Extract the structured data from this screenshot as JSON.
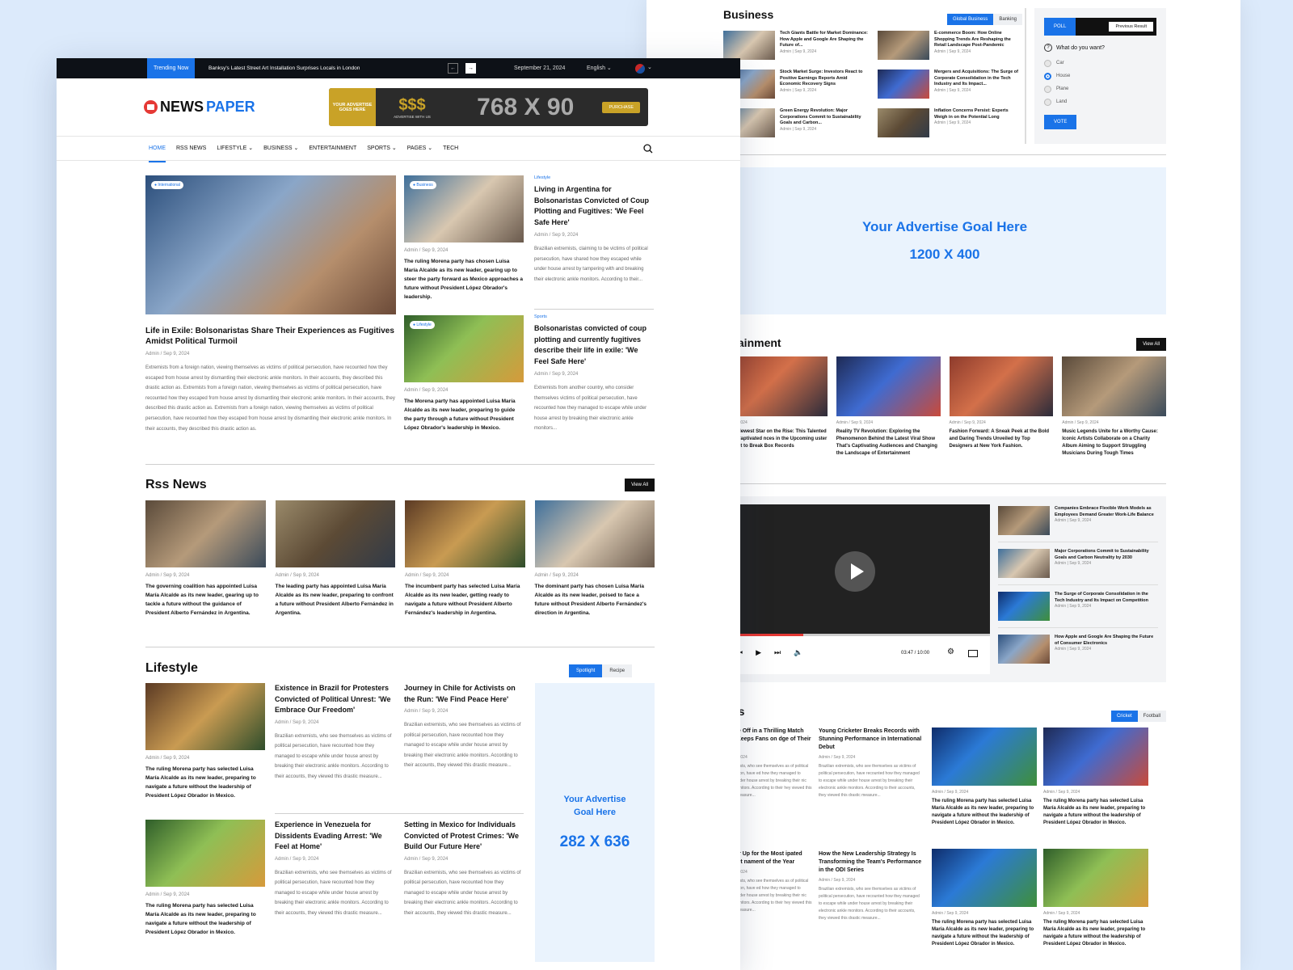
{
  "topbar": {
    "trending_label": "Trending Now",
    "trending_text": "Banksy's Latest Street Art Installation Surprises Locals in London",
    "date": "September 21, 2024",
    "language": "English"
  },
  "header": {
    "logo_news": "NEWS",
    "logo_paper": "PAPER",
    "ad_left": "YOUR ADVERTISE GOES HERE",
    "ad_dollars": "$$$",
    "ad_sub": "ADVERTISE WITH US",
    "ad_size": "768 X 90",
    "ad_button": "PURCHASE"
  },
  "nav": [
    "HOME",
    "RSS NEWS",
    "LIFESTYLE",
    "BUSINESS",
    "ENTERTAINMENT",
    "SPORTS",
    "PAGES",
    "TECH"
  ],
  "hero": {
    "main": {
      "badge": "International",
      "title": "Life in Exile: Bolsonaristas Share Their Experiences as Fugitives Amidst Political Turmoil",
      "meta": "Admin / Sep 9, 2024",
      "body": "Extremists from a foreign nation, viewing themselves as victims of political persecution, have recounted how they escaped from house arrest by dismantling their electronic ankle monitors. In their accounts, they described this drastic action as. Extremists from a foreign nation, viewing themselves as victims of political persecution, have recounted how they escaped from house arrest by dismantling their electronic ankle monitors. In their accounts, they described this drastic action as. Extremists from a foreign nation, viewing themselves as victims of political persecution, have recounted how they escaped from house arrest by dismantling their electronic ankle monitors. In their accounts, they described this drastic action as."
    },
    "card1": {
      "badge": "Business",
      "meta": "Admin / Sep 9, 2024",
      "text": "The ruling Morena party has chosen Luisa María Alcalde as its new leader, gearing up to steer the party forward as Mexico approaches a future without President López Obrador's leadership."
    },
    "card2": {
      "badge": "Lifestyle",
      "meta": "Admin / Sep 9, 2024",
      "text": "The Morena party has appointed Luisa María Alcalde as its new leader, preparing to guide the party through a future without President López Obrador's leadership in Mexico."
    },
    "side1": {
      "cat": "Lifestyle",
      "title": "Living in Argentina for Bolsonaristas Convicted of Coup Plotting and Fugitives: 'We Feel Safe Here'",
      "meta": "Admin / Sep 9, 2024",
      "body": "Brazilian extremists, claiming to be victims of political persecution, have shared how they escaped while under house arrest by tampering with and breaking their electronic ankle monitors. According to their..."
    },
    "side2": {
      "cat": "Sports",
      "title": "Bolsonaristas convicted of coup plotting and currently fugitives describe their life in exile: 'We Feel Safe Here'",
      "meta": "Admin / Sep 9, 2024",
      "body": "Extremists from another country, who consider themselves victims of political persecution, have recounted how they managed to escape while under house arrest by breaking their electronic ankle monitors..."
    }
  },
  "rss": {
    "title": "Rss News",
    "view_all": "View All",
    "items": [
      {
        "meta": "Admin / Sep 9, 2024",
        "text": "The governing coalition has appointed Luisa María Alcalde as its new leader, gearing up to tackle a future without the guidance of President Alberto Fernández in Argentina."
      },
      {
        "meta": "Admin / Sep 9, 2024",
        "text": "The leading party has appointed Luisa María Alcalde as its new leader, preparing to confront a future without President Alberto Fernández in Argentina."
      },
      {
        "meta": "Admin / Sep 9, 2024",
        "text": "The incumbent party has selected Luisa María Alcalde as its new leader, getting ready to navigate a future without President Alberto Fernández's leadership in Argentina."
      },
      {
        "meta": "Admin / Sep 9, 2024",
        "text": "The dominant party has chosen Luisa María Alcalde as its new leader, poised to face a future without President Alberto Fernández's direction in Argentina."
      }
    ]
  },
  "lifestyle": {
    "title": "Lifestyle",
    "tab1": "Spotlight",
    "tab2": "Recipe",
    "img1": {
      "meta": "Admin / Sep 9, 2024",
      "text": "The ruling Morena party has selected Luisa María Alcalde as its new leader, preparing to navigate a future without the leadership of President López Obrador in Mexico."
    },
    "img2": {
      "meta": "Admin / Sep 9, 2024",
      "text": "The ruling Morena party has selected Luisa María Alcalde as its new leader, preparing to navigate a future without the leadership of President López Obrador in Mexico."
    },
    "articles": [
      {
        "title": "Existence in Brazil for Protesters Convicted of Political Unrest: 'We Embrace Our Freedom'",
        "meta": "Admin / Sep 9, 2024",
        "body": "Brazilian extremists, who see themselves as victims of political persecution, have recounted how they managed to escape while under house arrest by breaking their electronic ankle monitors. According to their accounts, they viewed this drastic measure..."
      },
      {
        "title": "Journey in Chile for Activists on the Run: 'We Find Peace Here'",
        "meta": "Admin / Sep 9, 2024",
        "body": "Brazilian extremists, who see themselves as victims of political persecution, have recounted how they managed to escape while under house arrest by breaking their electronic ankle monitors. According to their accounts, they viewed this drastic measure..."
      },
      {
        "title": "Experience in Venezuela for Dissidents Evading Arrest: 'We Feel at Home'",
        "meta": "Admin / Sep 9, 2024",
        "body": "Brazilian extremists, who see themselves as victims of political persecution, have recounted how they managed to escape while under house arrest by breaking their electronic ankle monitors. According to their accounts, they viewed this drastic measure..."
      },
      {
        "title": "Setting in Mexico for Individuals Convicted of Protest Crimes: 'We Build Our Future Here'",
        "meta": "Admin / Sep 9, 2024",
        "body": "Brazilian extremists, who see themselves as victims of political persecution, have recounted how they managed to escape while under house arrest by breaking their electronic ankle monitors. According to their accounts, they viewed this drastic measure..."
      }
    ],
    "ad_line1": "Your Advertise",
    "ad_line2": "Goal Here",
    "ad_size": "282 X 636"
  },
  "business": {
    "title": "Business",
    "tab1": "Global Business",
    "tab2": "Banking",
    "items": [
      {
        "title": "Tech Giants Battle for Market Dominance: How Apple and Google Are Shaping the Future of...",
        "meta": "Admin | Sep 9, 2024"
      },
      {
        "title": "E-commerce Boom: How Online Shopping Trends Are Reshaping the Retail Landscape Post-Pandemic",
        "meta": "Admin | Sep 9, 2024"
      },
      {
        "title": "Stock Market Surge: Investors React to Positive Earnings Reports Amid Economic Recovery Signs",
        "meta": "Admin | Sep 9, 2024"
      },
      {
        "title": "Mergers and Acquisitions: The Surge of Corporate Consolidation in the Tech Industry and Its Impact...",
        "meta": "Admin | Sep 9, 2024"
      },
      {
        "title": "Green Energy Revolution: Major Corporations Commit to Sustainability Goals and Carbon...",
        "meta": "Admin | Sep 9, 2024"
      },
      {
        "title": "Inflation Concerns Persist: Experts Weigh in on the Potential Long",
        "meta": "Admin | Sep 9, 2024"
      }
    ]
  },
  "poll": {
    "tab1": "POLL",
    "tab2": "Previous Result",
    "question": "What do you want?",
    "options": [
      "Car",
      "House",
      "Plane",
      "Land"
    ],
    "vote": "VOTE"
  },
  "big_ad": {
    "line1": "Your Advertise Goal Here",
    "line2": "1200 X 400"
  },
  "entertainment": {
    "title": "ertainment",
    "view_all": "View All",
    "items": [
      {
        "meta": "/ Sep 9, 2024",
        "title": "ood's Newest Star on the Rise: This Talented Actor Captivated nces in the Upcoming uster Film Set to Break Box Records"
      },
      {
        "meta": "Admin / Sep 9, 2024",
        "title": "Reality TV Revolution: Exploring the Phenomenon Behind the Latest Viral Show That's Captivating Audiences and Changing the Landscape of Entertainment"
      },
      {
        "meta": "Admin / Sep 9, 2024",
        "title": "Fashion Forward: A Sneak Peek at the Bold and Daring Trends Unveiled by Top Designers at New York Fashion."
      },
      {
        "meta": "Admin / Sep 9, 2024",
        "title": "Music Legends Unite for a Worthy Cause: Iconic Artists Collaborate on a Charity Album Aiming to Support Struggling Musicians During Tough Times"
      }
    ]
  },
  "video": {
    "time": "03:47 / 10:00",
    "progress": 0.3,
    "list": [
      {
        "title": "Companies Embrace Flexible Work Models as Employees Demand Greater Work-Life Balance",
        "meta": "Admin | Sep 9, 2024"
      },
      {
        "title": "Major Corporations Commit to Sustainability Goals and Carbon Neutrality by 2030",
        "meta": "Admin | Sep 9, 2024"
      },
      {
        "title": "The Surge of Corporate Consolidation in the Tech Industry and Its Impact on Competition",
        "meta": "Admin | Sep 9, 2024"
      },
      {
        "title": "How Apple and Google Are Shaping the Future of Consumer Electronics",
        "meta": "Admin | Sep 9, 2024"
      }
    ]
  },
  "sports": {
    "title": "orts",
    "tab1": "Cricket",
    "tab2": "Football",
    "text_items": [
      {
        "title": "s Face Off in a Thrilling Match That Keeps Fans on dge of Their Seats",
        "meta": "/ Sep 9, 2024",
        "body": "n extremists, who see themselves as of political persecution, have ed how they managed to escape nder house arrest by breaking their nic ankle monitors. According to their hey viewed this drastic measure..."
      },
      {
        "title": "Young Cricketer Breaks Records with Stunning Performance in International Debut",
        "meta": "Admin / Sep 9, 2024",
        "body": "Brazilian extremists, who see themselves as victims of political persecution, have recounted how they managed to escape while under house arrest by breaking their electronic ankle monitors. According to their accounts, they viewed this drastic measure..."
      },
      {
        "title": "s Gear Up for the Most ipated Cricket nament of the Year",
        "meta": "/ Sep 9, 2024",
        "body": "n extremists, who see themselves as of political persecution, have ed how they managed to escape nder house arrest by breaking their nic ankle monitors. According to their hey viewed this drastic measure..."
      },
      {
        "title": "How the New Leadership Strategy Is Transforming the Team's Performance in the ODI Series",
        "meta": "Admin / Sep 9, 2024",
        "body": "Brazilian extremists, who see themselves as victims of political persecution, have recounted how they managed to escape while under house arrest by breaking their electronic ankle monitors. According to their accounts, they viewed this drastic measure..."
      }
    ],
    "img_items": [
      {
        "meta": "Admin / Sep 9, 2024",
        "text": "The ruling Morena party has selected Luisa María Alcalde as its new leader, preparing to navigate a future without the leadership of President López Obrador in Mexico."
      },
      {
        "meta": "Admin / Sep 9, 2024",
        "text": "The ruling Morena party has selected Luisa María Alcalde as its new leader, preparing to navigate a future without the leadership of President López Obrador in Mexico."
      },
      {
        "meta": "Admin / Sep 9, 2024",
        "text": "The ruling Morena party has selected Luisa María Alcalde as its new leader, preparing to navigate a future without the leadership of President López Obrador in Mexico."
      },
      {
        "meta": "Admin / Sep 9, 2024",
        "text": "The ruling Morena party has selected Luisa María Alcalde as its new leader, preparing to navigate a future without the leadership of President López Obrador in Mexico."
      }
    ]
  }
}
